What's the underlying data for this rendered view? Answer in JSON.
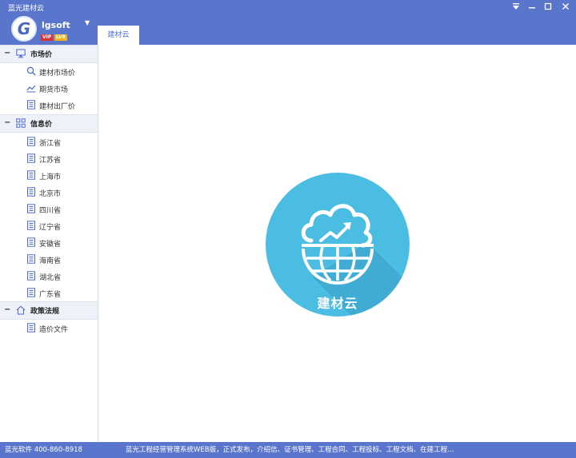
{
  "app": {
    "title": "蓝光建材云"
  },
  "user": {
    "name": "lgsoft",
    "logo_letter": "G",
    "vip_label": "VIP",
    "level_label": "LV8"
  },
  "window": {
    "menu_icon": "triangle-down-icon",
    "minimize_icon": "minimize-icon",
    "maximize_icon": "maximize-icon",
    "close_icon": "close-icon"
  },
  "tabs": [
    {
      "label": "建材云"
    }
  ],
  "sidebar": {
    "groups": [
      {
        "label": "市场价",
        "icon": "monitor-icon",
        "items": [
          {
            "label": "建材市场价",
            "icon": "search-icon"
          },
          {
            "label": "期货市场",
            "icon": "line-chart-icon"
          },
          {
            "label": "建材出厂价",
            "icon": "document-icon"
          }
        ]
      },
      {
        "label": "信息价",
        "icon": "grid-icon",
        "items": [
          {
            "label": "浙江省",
            "icon": "document-icon"
          },
          {
            "label": "江苏省",
            "icon": "document-icon"
          },
          {
            "label": "上海市",
            "icon": "document-icon"
          },
          {
            "label": "北京市",
            "icon": "document-icon"
          },
          {
            "label": "四川省",
            "icon": "document-icon"
          },
          {
            "label": "辽宁省",
            "icon": "document-icon"
          },
          {
            "label": "安徽省",
            "icon": "document-icon"
          },
          {
            "label": "海南省",
            "icon": "document-icon"
          },
          {
            "label": "湖北省",
            "icon": "document-icon"
          },
          {
            "label": "广东省",
            "icon": "document-icon"
          }
        ]
      },
      {
        "label": "政策法规",
        "icon": "home-icon",
        "items": [
          {
            "label": "造价文件",
            "icon": "document-icon"
          }
        ]
      }
    ]
  },
  "main": {
    "hero_label": "建材云",
    "hero_icon": "cloud-globe-icon"
  },
  "status": {
    "left": "蓝光软件 400-860-8918",
    "right": "蓝光工程经营管理系统WEB版，正式发布，介绍信、证书管理、工程合同、工程投标、工程文档、在建工程..."
  },
  "colors": {
    "brand_blue": "#5a75cc",
    "hero_circle": "#4bbde3",
    "hero_shadow": "#3a9fc7",
    "sidebar_head": "#eef1f8"
  }
}
